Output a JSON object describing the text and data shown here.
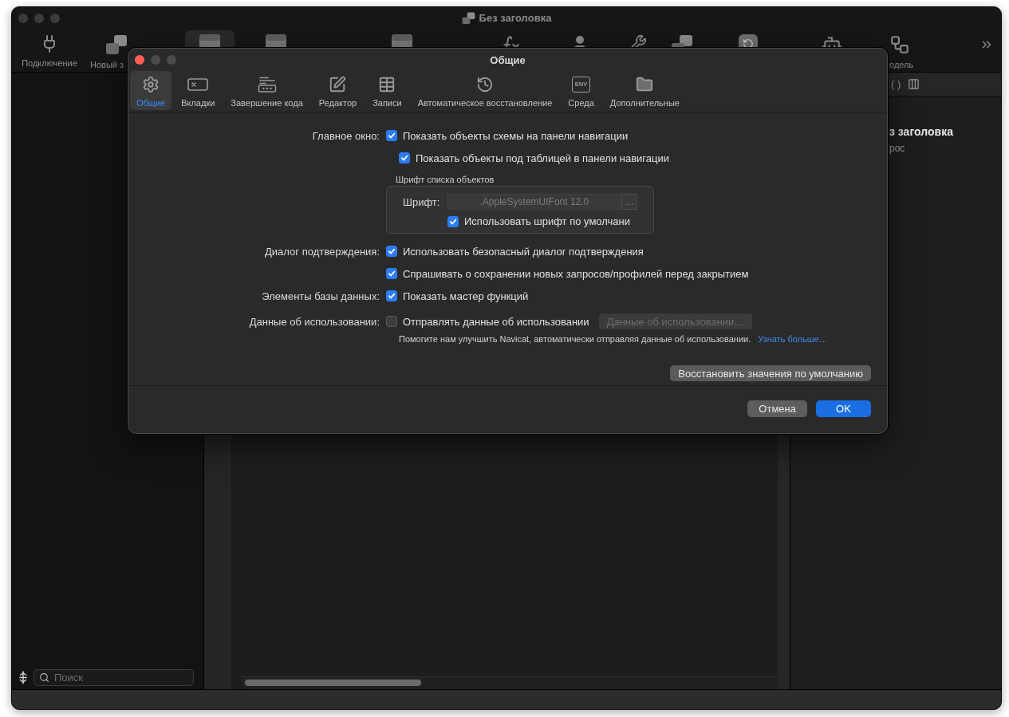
{
  "window": {
    "title": "Без заголовка"
  },
  "toolbar": {
    "items": [
      {
        "label": "Подключение",
        "selected": false
      },
      {
        "label": "Новый з",
        "selected": false
      },
      {
        "selected": true
      },
      {
        "selected": false
      },
      {
        "selected": false
      },
      {
        "selected": false
      },
      {
        "selected": false
      },
      {
        "selected": false
      },
      {
        "selected": false
      },
      {
        "selected": false
      },
      {
        "selected": false
      },
      {
        "label": "одель",
        "selected": false
      }
    ]
  },
  "sidebar": {
    "search": {
      "placeholder": "Поиск"
    }
  },
  "right_panel": {
    "toolbar_glyph": "( )",
    "title": "з заголовка",
    "subtitle": "рос"
  },
  "dialog": {
    "title": "Общие",
    "tabs": [
      {
        "label": "Общие",
        "selected": true
      },
      {
        "label": "Вкладки",
        "selected": false
      },
      {
        "label": "Завершение кода",
        "selected": false
      },
      {
        "label": "Редактор",
        "selected": false
      },
      {
        "label": "Записи",
        "selected": false
      },
      {
        "label": "Автоматическое восстановление",
        "selected": false
      },
      {
        "label": "Среда",
        "icon_text": "ENV",
        "selected": false
      },
      {
        "label": "Дополнительные",
        "selected": false
      }
    ],
    "settings": [
      {
        "kind": "checkbox",
        "label": "Главное окно:",
        "text": "Показать объекты схемы на панели навигации",
        "checked": true,
        "children": [
          {
            "text": "Показать объекты под таблицей в панели навигации",
            "checked": true
          }
        ]
      },
      {
        "kind": "font_group",
        "title": "Шрифт списка объектов",
        "field": {
          "label": "Шрифт:",
          "value": ".AppleSystemUIFont 12.0",
          "disabled": true
        },
        "browse_button": "…",
        "option": {
          "text": "Использовать шрифт по умолчани",
          "checked": true
        }
      },
      {
        "kind": "checkbox",
        "label": "Диалог подтверждения:",
        "text": "Использовать безопасный диалог подтверждения",
        "checked": true
      },
      {
        "kind": "checkbox",
        "text": "Спрашивать о сохранении новых запросов/профилей перед закрытием",
        "checked": true
      },
      {
        "kind": "checkbox",
        "label": "Элементы базы данных:",
        "text": "Показать мастер функций",
        "checked": true
      },
      {
        "kind": "checkbox",
        "label": "Данные об использовании:",
        "text": "Отправлять данные об использовании",
        "checked": false,
        "button": {
          "label": "Данные об использовании…",
          "disabled": true
        }
      },
      {
        "kind": "hint",
        "text": "Помогите нам улучшить Navicat, автоматически отправляя данные об использовании.",
        "link": "Узнать больше…"
      }
    ],
    "restore_button": "Восстановить значения по умолчанию",
    "buttons": [
      {
        "label": "Отмена",
        "default": false
      },
      {
        "label": "OK",
        "default": true
      }
    ]
  }
}
